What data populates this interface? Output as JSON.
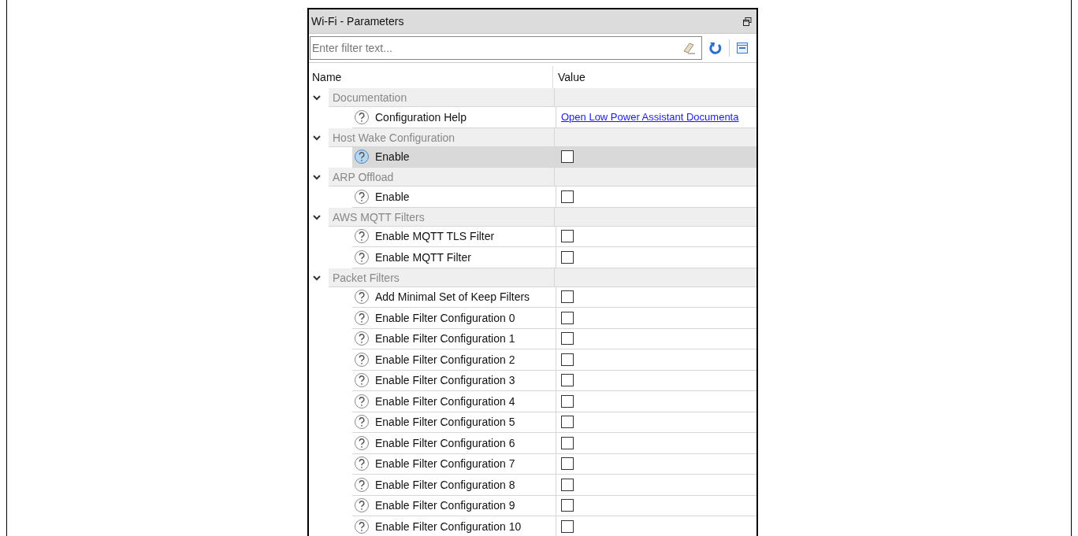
{
  "window": {
    "title": "Wi-Fi - Parameters"
  },
  "filter": {
    "placeholder": "Enter filter text..."
  },
  "columns": [
    "Name",
    "Value"
  ],
  "groups": [
    {
      "label": "Documentation",
      "expanded": true,
      "children": [
        {
          "label": "Configuration Help",
          "kind": "link",
          "value": "Open Low Power Assistant Documenta",
          "selected": false
        }
      ]
    },
    {
      "label": "Host Wake Configuration",
      "expanded": true,
      "children": [
        {
          "label": "Enable",
          "kind": "checkbox",
          "checked": false,
          "selected": true
        }
      ]
    },
    {
      "label": "ARP Offload",
      "expanded": true,
      "children": [
        {
          "label": "Enable",
          "kind": "checkbox",
          "checked": false,
          "selected": false
        }
      ]
    },
    {
      "label": "AWS MQTT Filters",
      "expanded": true,
      "children": [
        {
          "label": "Enable MQTT TLS Filter",
          "kind": "checkbox",
          "checked": false,
          "selected": false
        },
        {
          "label": "Enable MQTT Filter",
          "kind": "checkbox",
          "checked": false,
          "selected": false
        }
      ]
    },
    {
      "label": "Packet Filters",
      "expanded": true,
      "children": [
        {
          "label": "Add Minimal Set of Keep Filters",
          "kind": "checkbox",
          "checked": false,
          "selected": false
        },
        {
          "label": "Enable Filter Configuration 0",
          "kind": "checkbox",
          "checked": false,
          "selected": false
        },
        {
          "label": "Enable Filter Configuration 1",
          "kind": "checkbox",
          "checked": false,
          "selected": false
        },
        {
          "label": "Enable Filter Configuration 2",
          "kind": "checkbox",
          "checked": false,
          "selected": false
        },
        {
          "label": "Enable Filter Configuration 3",
          "kind": "checkbox",
          "checked": false,
          "selected": false
        },
        {
          "label": "Enable Filter Configuration 4",
          "kind": "checkbox",
          "checked": false,
          "selected": false
        },
        {
          "label": "Enable Filter Configuration 5",
          "kind": "checkbox",
          "checked": false,
          "selected": false
        },
        {
          "label": "Enable Filter Configuration 6",
          "kind": "checkbox",
          "checked": false,
          "selected": false
        },
        {
          "label": "Enable Filter Configuration 7",
          "kind": "checkbox",
          "checked": false,
          "selected": false
        },
        {
          "label": "Enable Filter Configuration 8",
          "kind": "checkbox",
          "checked": false,
          "selected": false
        },
        {
          "label": "Enable Filter Configuration 9",
          "kind": "checkbox",
          "checked": false,
          "selected": false
        },
        {
          "label": "Enable Filter Configuration 10",
          "kind": "checkbox",
          "checked": false,
          "selected": false
        }
      ]
    }
  ]
}
